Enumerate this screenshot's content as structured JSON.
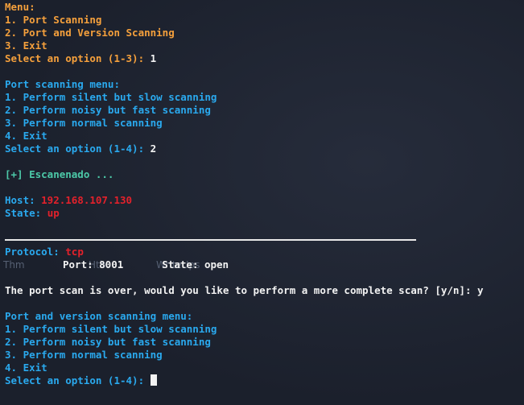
{
  "main_menu": {
    "title": "Menu:",
    "options": [
      "1. Port Scanning",
      "2. Port and Version Scanning",
      "3. Exit"
    ],
    "prompt": "Select an option (1-3): ",
    "input": "1"
  },
  "port_scan_menu": {
    "title": "Port scanning menu:",
    "options": [
      "1. Perform silent but slow scanning",
      "2. Perform noisy but fast scanning",
      "3. Perform normal scanning",
      "4. Exit"
    ],
    "prompt": "Select an option (1-4): ",
    "input": "2"
  },
  "scanning_status": "[+] Escanenado ...",
  "host": {
    "label": "Host: ",
    "value": "192.168.107.130"
  },
  "state": {
    "label": "State: ",
    "value": "up"
  },
  "protocol": {
    "label": "Protocol: ",
    "value": "tcp"
  },
  "port_result": {
    "port_label": "Port: ",
    "port": "8001",
    "state_label": "State: ",
    "state": "open"
  },
  "complete_scan_prompt": "The port scan is over, would you like to perform a more complete scan? [y/n]: ",
  "complete_scan_input": "y",
  "version_scan_menu": {
    "title": "Port and version scanning menu:",
    "options": [
      "1. Perform silent but slow scanning",
      "2. Perform noisy but fast scanning",
      "3. Perform normal scanning",
      "4. Exit"
    ],
    "prompt": "Select an option (1-4): "
  },
  "background_labels": [
    "Thm",
    "Htb",
    "WriteUps"
  ],
  "colors": {
    "background": "#1d2230",
    "orange": "#f5a03c",
    "blue": "#2aa9ee",
    "green": "#4cc9a8",
    "red": "#e3212b",
    "white": "#f2f2f2"
  }
}
